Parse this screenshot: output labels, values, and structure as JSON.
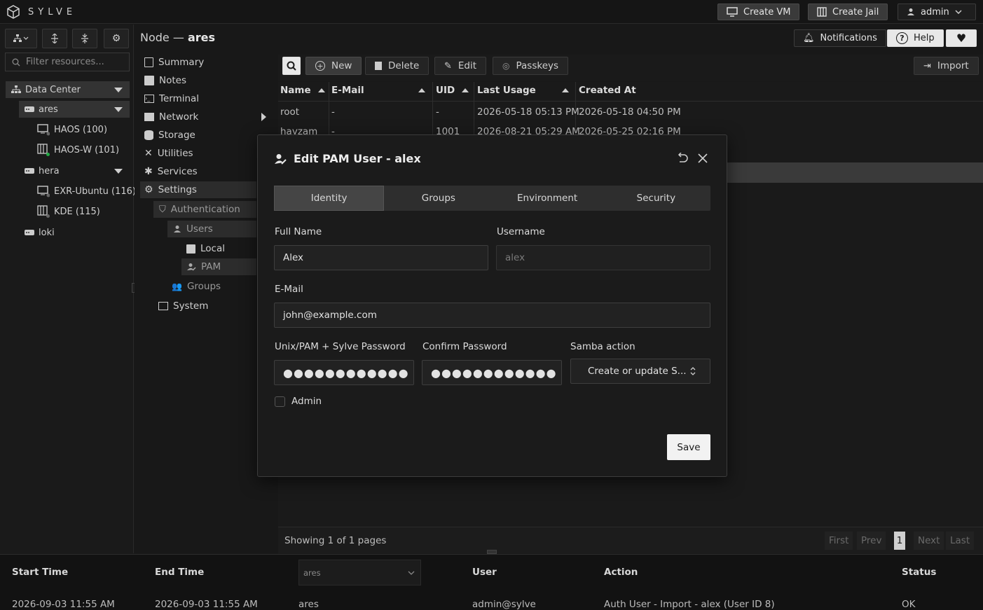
{
  "app": {
    "brand": "SYLVE"
  },
  "topbar": {
    "create_vm": "Create VM",
    "create_jail": "Create Jail",
    "user": "admin"
  },
  "header": {
    "node_prefix": "Node — ",
    "node_name": "ares",
    "notifications": "Notifications",
    "help": "Help"
  },
  "sidebar": {
    "filter_placeholder": "Filter resources...",
    "tree": {
      "datacenter": "Data Center",
      "nodes": [
        {
          "name": "ares",
          "guests": [
            "HAOS (100)",
            "HAOS-W (101)"
          ]
        },
        {
          "name": "hera",
          "guests": [
            "EXR-Ubuntu (116)",
            "KDE (115)"
          ]
        },
        {
          "name": "loki",
          "guests": []
        }
      ]
    }
  },
  "nav": {
    "items": [
      "Summary",
      "Notes",
      "Terminal",
      "Network",
      "Storage",
      "Utilities",
      "Services",
      "Settings"
    ],
    "settings": {
      "authentication": "Authentication",
      "users": "Users",
      "local": "Local",
      "pam": "PAM",
      "groups": "Groups",
      "system": "System"
    }
  },
  "toolbar": {
    "new": "New",
    "delete": "Delete",
    "edit": "Edit",
    "passkeys": "Passkeys",
    "import": "Import"
  },
  "table": {
    "columns": [
      "Name",
      "E-Mail",
      "UID",
      "Last Usage",
      "Created At"
    ],
    "rows": [
      [
        "root",
        "-",
        "-",
        "2026-05-18 05:13 PM",
        "2026-05-18 04:50 PM"
      ],
      [
        "hayzam",
        "-",
        "1001",
        "2026-08-21 05:29 AM",
        "2026-05-25 02:16 PM"
      ]
    ]
  },
  "pagination": {
    "showing": "Showing 1 of 1 pages",
    "first": "First",
    "prev": "Prev",
    "current": "1",
    "next": "Next",
    "last": "Last"
  },
  "log": {
    "columns": [
      "Start Time",
      "End Time",
      "User",
      "Action",
      "Status"
    ],
    "node_filter": "ares",
    "row": [
      "2026-09-03 11:55 AM",
      "2026-09-03 11:55 AM",
      "ares",
      "admin@sylve",
      "Auth User - Import - alex (User ID 8)",
      "OK"
    ]
  },
  "modal": {
    "title": "Edit PAM User - alex",
    "tabs": [
      "Identity",
      "Groups",
      "Environment",
      "Security"
    ],
    "active_tab": "Identity",
    "full_name_label": "Full Name",
    "full_name_value": "Alex",
    "username_label": "Username",
    "username_value": "alex",
    "email_label": "E-Mail",
    "email_value": "john@example.com",
    "password_label": "Unix/PAM + Sylve Password",
    "password_value": "●●●●●●●●●●●●",
    "confirm_label": "Confirm Password",
    "confirm_value": "●●●●●●●●●●●●",
    "samba_label": "Samba action",
    "samba_value": "Create or update S...",
    "admin_label": "Admin",
    "save": "Save"
  }
}
